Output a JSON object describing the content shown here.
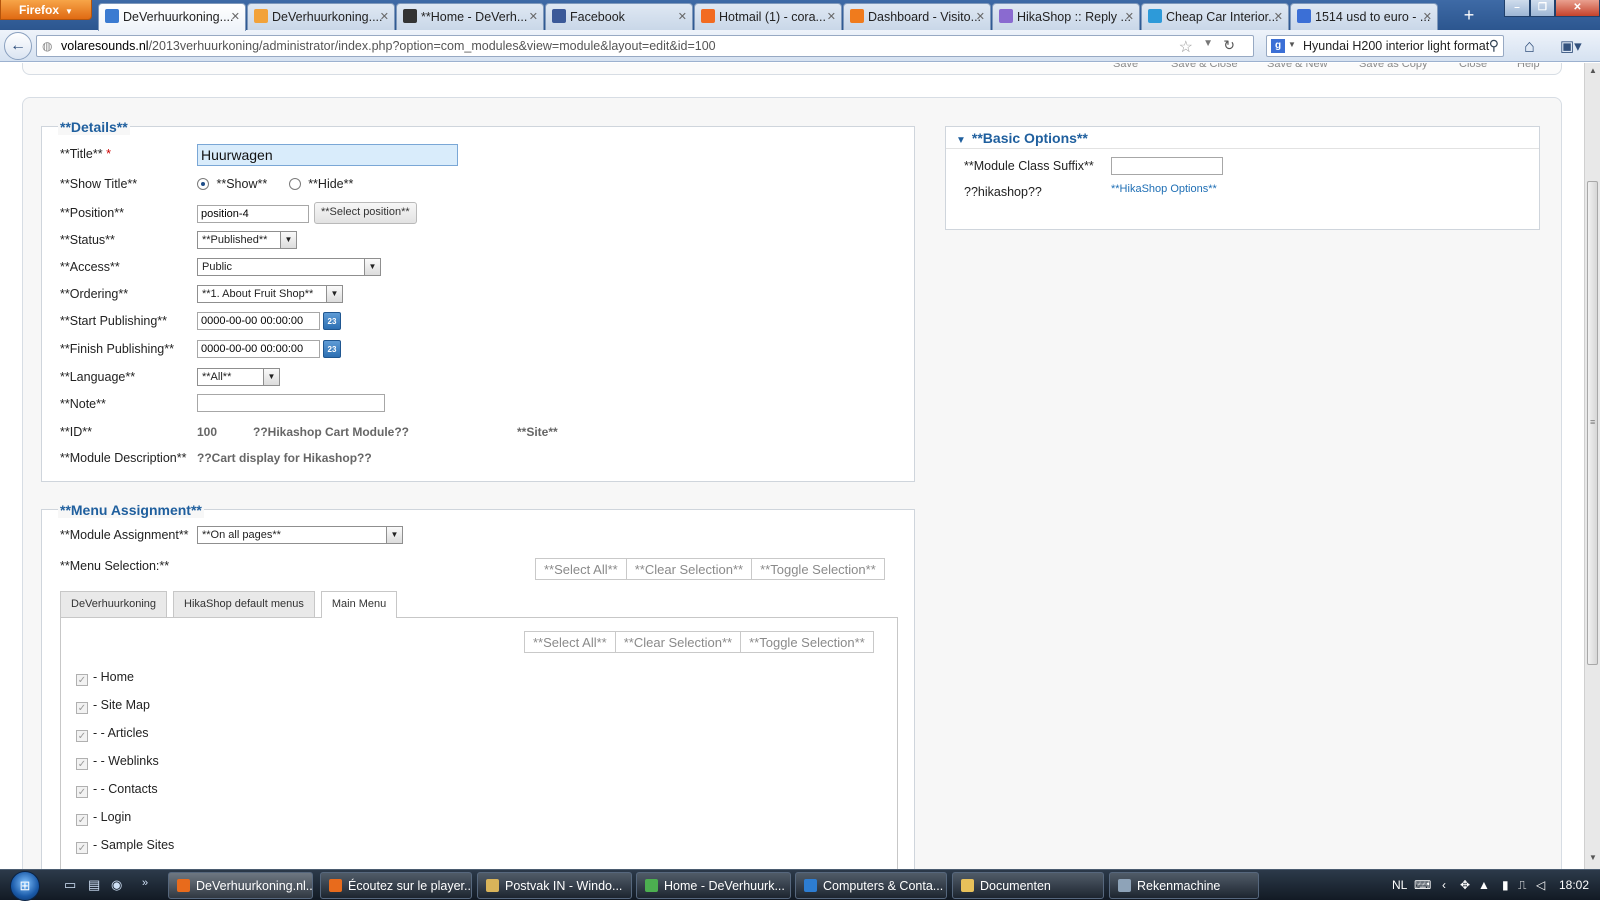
{
  "browser": {
    "app_button": "Firefox",
    "tabs": [
      {
        "label": "DeVerhuurkoning....",
        "fav": "#3b7bd1",
        "active": true
      },
      {
        "label": "DeVerhuurkoning....",
        "fav": "#f2a23a",
        "active": false
      },
      {
        "label": "**Home - DeVerh...",
        "fav": "#333333",
        "active": false
      },
      {
        "label": "Facebook",
        "fav": "#3b5998",
        "active": false
      },
      {
        "label": "Hotmail (1) - cora...",
        "fav": "#f26b21",
        "active": false
      },
      {
        "label": "Dashboard - Visito...",
        "fav": "#f07b1d",
        "active": false
      },
      {
        "label": "HikaShop :: Reply ...",
        "fav": "#8a6ad0",
        "active": false
      },
      {
        "label": "Cheap Car Interior...",
        "fav": "#2d9ad9",
        "active": false
      },
      {
        "label": "1514 usd to euro - ...",
        "fav": "#3b6fd6",
        "active": false
      }
    ],
    "url_host": "volaresounds.nl",
    "url_path": "/2013verhuurkoning/administrator/index.php?option=com_modules&view=module&layout=edit&id=100",
    "search_value": "Hyundai H200 interior light format"
  },
  "details": {
    "legend": "**Details**",
    "title_label": "**Title**",
    "title_req": "*",
    "title_value": "Huurwagen",
    "show_title_label": "**Show Title**",
    "show_option": "**Show**",
    "hide_option": "**Hide**",
    "position_label": "**Position**",
    "position_value": "position-4",
    "select_position": "**Select position**",
    "status_label": "**Status**",
    "status_value": "**Published**",
    "access_label": "**Access**",
    "access_value": "Public",
    "ordering_label": "**Ordering**",
    "ordering_value": "**1. About Fruit Shop**",
    "start_label": "**Start Publishing**",
    "start_value": "0000-00-00 00:00:00",
    "finish_label": "**Finish Publishing**",
    "finish_value": "0000-00-00 00:00:00",
    "calendar_icon_text": "23",
    "language_label": "**Language**",
    "language_value": "**All**",
    "note_label": "**Note**",
    "note_value": "",
    "id_label": "**ID**",
    "id_value": "100",
    "module_type": "??Hikashop Cart Module??",
    "client": "**Site**",
    "desc_label": "**Module Description**",
    "desc_value": "??Cart display for Hikashop??"
  },
  "menu": {
    "legend": "**Menu Assignment**",
    "assignment_label": "**Module Assignment**",
    "assignment_value": "**On all pages**",
    "selection_label": "**Menu Selection:**",
    "select_all": "**Select All**",
    "clear_selection": "**Clear Selection**",
    "toggle_selection": "**Toggle Selection**",
    "tabs": [
      "DeVerhuurkoning",
      "HikaShop default menus",
      "Main Menu"
    ],
    "items": [
      "- Home",
      "- Site Map",
      "- - Articles",
      "- - Weblinks",
      "- - Contacts",
      "- Login",
      "- Sample Sites"
    ]
  },
  "options": {
    "header": "**Basic Options**",
    "suffix_label": "**Module Class Suffix**",
    "suffix_value": "",
    "hikashop_label": "??hikashop??",
    "hikashop_link": "**HikaShop Options**"
  },
  "taskbar": {
    "items": [
      {
        "label": "DeVerhuurkoning.nl...",
        "icon": "#e86b1c",
        "active": true
      },
      {
        "label": "Écoutez sur le player...",
        "icon": "#e86b1c",
        "active": false
      },
      {
        "label": "Postvak IN - Windo...",
        "icon": "#d9b45a",
        "active": false
      },
      {
        "label": "Home - DeVerhuurk...",
        "icon": "#4caf50",
        "active": false
      },
      {
        "label": "Computers & Conta...",
        "icon": "#2d7dd2",
        "active": false
      },
      {
        "label": "Documenten",
        "icon": "#e8c15a",
        "active": false
      },
      {
        "label": "Rekenmachine",
        "icon": "#8ea3b8",
        "active": false
      }
    ],
    "lang": "NL",
    "time": "18:02"
  }
}
